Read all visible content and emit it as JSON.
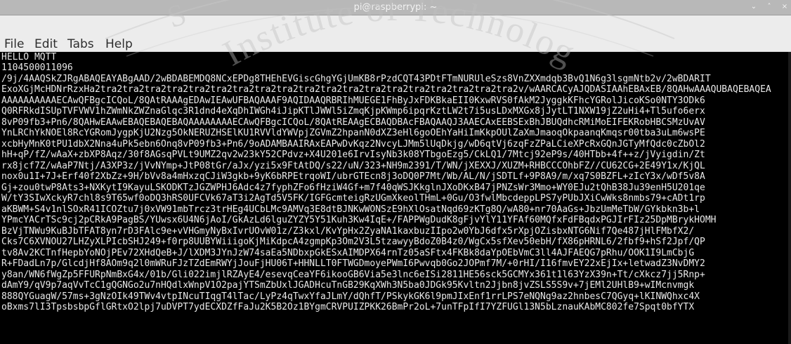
{
  "window": {
    "title": "pi@raspberrypi: ~",
    "controls": {
      "minimize_icon": "⌄",
      "maximize_icon": "˄",
      "close_icon": "×"
    }
  },
  "menubar": {
    "file": "File",
    "edit": "Edit",
    "tabs": "Tabs",
    "help": "Help"
  },
  "watermark": {
    "text_left": "S",
    "text_mid": "Institute of Technology"
  },
  "terminal": {
    "lines": [
      "HELLO MQTT",
      "1104500011096",
      "/9j/4AAQSkZJRgABAQEAYABgAAD/2wBDABEMDQ8NCxEPDg8THEhEVGiscGhgYGjUmKB8rPzdCQT43PDtFTmNURUleSzs8VnZXXmdqb3BvQ1N6g3lsgmNtb2v/2wBDARIT",
      "ExoXGjMcHDNrRzxHa2tra2tra2tra2tra2tra2tra2tra2tra2tra2tra2tra2tra2tra2tra2tra2tra2tra2tra2tra2v/wAARCACyAJQDASIAAhEBAxEB/8QAHwAAAQUBAQEBAQEA",
      "AAAAAAAAAAECAwQFBgcICQoL/8QAtRAAAgEDAwIEAwUFBAQAAAF9AQIDAAQRBRIhMUEGE1FhByJxFDKBkaEII0KxwRVS0fAkM2JyggkKFhcYGRolJicoKSo0NTY3ODk6",
      "Q0RFRkdISUpTVFVWV1hZWmNkZWZnaGlqc3R1dnd4eXqDhIWGh4iJipKTlJWWl5iZmqKjpKWmp6ipqrKztLW2t7i5usLDxMXGx8jJytLT1NXW19jZ2uHi4+Tl5ufo6erx",
      "8vP09fb3+Pn6/8QAHwEAAwEBAQEBAQEBAQAAAAAAAAECAwQFBgcICQoL/8QAtREAAgECBAQDBAcFBAQAAQJ3AAECAxEEBSExBhJBUQdhcRMiMoEIFEKRobHBCSMzUvAV",
      "YnLRChYkNOEl8RcYGRomJygpKjU2Nzg5OkNERUZHSElKU1RVVldYWVpjZGVmZ2hpanN0dXZ3eHl6goOEhYaHiImKkpOUlZaXmJmaoqOkpaanqKmqsr00tba3uLm6wsPE",
      "xcbHyMnK0tPU1dbX2Nna4uPk5ebn6Onq8vP09fb3+Pn6/9oADAMBAAIRAxEAPwDvKqz2NvcyLJMm5lUqDkjg/wD6qtVj6zqFzZPaLCieXPcRxGQnJGTyMfQdc0cZbOl2",
      "hH+qP/fZ/wAaX+zbXP8Aqz/30f8AGsqPVLt9UMZ2qv2w23kY52CPdvz+X4U201e6IrvIsyNb3k08YTbgoEzg5/CkLQ1/7Mtcj92eP9s/40HTbb+4f++z/jVyigdin/Zt",
      "rx8jcf7Z/wAaP7Ntj/A3XP3z/jVvNYmp+JtP08tGr/aJx/yzi5x9FtAtDQ/s22/uN/323+NH9m2391/T/WN/jXEXXJ/XUZM+RHBCCCOhbFZ//CU62CG+2E49Y1x/KjQL",
      "nox0u1I+7J+Erf40f2XbZz+9H/bVv8a4mHxzqCJiW3gkb+9yK6bRPEtrqoWI/ubrGTEcn8j3oDQ0P7Mt/Wb/AL/N/jSDTLf+9P8A9/m/xq7S0BZFL+zIcY3x/wDf5v8A",
      "Gj+zou0twP8Ats3+NXKytI9KayuLSKODKTzJGZWPHJ6Adc4z7fyphZFo6fHziW4Gf+m7f40qWSJKkglnJXoDKxB47jPNZsWr3Mmo+WY0EJu2tQhB38Ju39enH5U201qe",
      "W/tY3SIwXckyR7chl8s9T65wf0oDQ3hRS0UFCVk67aT3i2AgTd5V5FK/IGFGcmteigRzUGmXkeolTHmL+0Gu/O3fwlMbcdeppLPS7yPUbJXiCwWks8nmbs79+cADt1rp",
      "aKBWM+S4v1nlSOxR41ICOZtu7j0xVW91mbTrcz3trHEg4UCbLMc9AMVq3E8dtBJNKwWONSzE9hXlOsatNqd69zKTg8Q/wA80+nr70AaGs+JbzUmMeTbW/GYkbkn3b+l",
      "YPmcYACrTSc9cj2pCRkA9PagBS/YUwsx6U4N6jAoI/GkAzLd6lguZYZY5Y51Kuh3Kw4IqE+/FAPPWgDudK8gFjvYlY11YFAf60MQfxFdFBqdxPGJIrFIz25DpMBrykHOMH",
      "BzVjTNWu9KuBJbTFAT8yn7rD3FAlc9e+vVHGmyNyBxIvrUOvW01z/Z3kxl/KvYpHx2ZyaNA1kaxbuzIIpo2w0YbJ6dfx5rXpjOZisbxNTG6Nif7Qe487jHlFMbfX2/",
      "Cks7C6XVNOU27LHZyXLPIcbSHJ249+f0rp8UUBYWiiigoKjMiKdpcA4zgmpKp3Om2V3L5tzawyyBdoZ0B4z0/WgCx5sfXev50ebH/fX86pHRNL6/2fbf9+hSf2Jpf/QP",
      "tv8Av2KCTnfHepbYoNOjPEv72XHdQeB+J/lXDM3JYnJzW74saEa5NDbxpGkESxAIMDPX64rnTz05aSFtx4FKBk8daYpOEbVmC3ll4AJFAEQG7pRhu/OOK1I9LmCbjG",
      "R+FDadLn7p/GlcdjHf8AOm9q2l0mWRuFJzTZdEmRWYjJouFjHU06T+HHNLLT0FTWGDmoyePWmI6Pwvqb0Go2JOPmf7M/+0rHI/I16fmvEY22xEjIx+letwadZ3NvDMY2",
      "y8an/WN6fWgZp5FFURpNmBxG4x/01b/Gli022imjlRZAyE4/esevqCeaYF6ikooGB6Via5e3lnc6eISi2811HE56sck5GCMYx361t1l63YzX39n+Tt/cXkcz7jj5Rnp+",
      "dAmY9/qV9p7aqVvTcC1gQGNGo2u7nHQdlxWnpV1O2pajYTSmZbUxlJGADHcuTnGB29KqXWh3N5ba0JDGk95Kvltn2Jjbn8jvZSLS5S9v+7jEMl2UHlB9+wIMcnvmgk",
      "888QYGuagW/57ms+3gNzOIk49TWv4vtpINcuTIqgT4lTac/LyPz4qTwxYfaJLmY/dQhfT/PSkykGK6l9pmJIxEnf1rrLPS7eNQNg9az2hnbesC7QGyq+lKINWQhxc4X",
      "oBxms7lI3TpsbsbpGflGRtxO2lpj7uDVPT7ydECXDZfFaJu2K5B2Oz1BYgmCRVPUIZPKK26BmPr2oL+7unTFpIfI7YZFUGl13N5bLznauKAbMC802fe7Spqt0bfYTX"
    ]
  }
}
